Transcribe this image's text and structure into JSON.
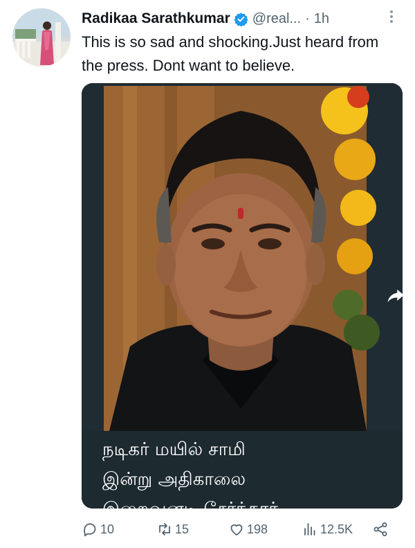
{
  "tweet": {
    "author": {
      "display_name": "Radikaa Sarathkumar",
      "verified": true,
      "handle": "@real...",
      "time_separator": "·",
      "time": "1h"
    },
    "text": "This is so sad and shocking.Just heard from the press. Dont want to believe.",
    "media": {
      "caption": "நடிகர் மயில் சாமி\nஇன்று அதிகாலை\nஇறைவனடி சேர்ந்தார்"
    },
    "actions": {
      "replies": "10",
      "retweets": "15",
      "likes": "198",
      "views": "12.5K"
    }
  },
  "colors": {
    "text_primary": "#0f1419",
    "text_secondary": "#536471",
    "verified_blue": "#1d9bf0",
    "media_background": "#1d2a30"
  },
  "icons": [
    "verified-badge-icon",
    "more-options-icon",
    "share-arrow-icon",
    "reply-icon",
    "retweet-icon",
    "like-icon",
    "views-icon",
    "share-icon"
  ]
}
